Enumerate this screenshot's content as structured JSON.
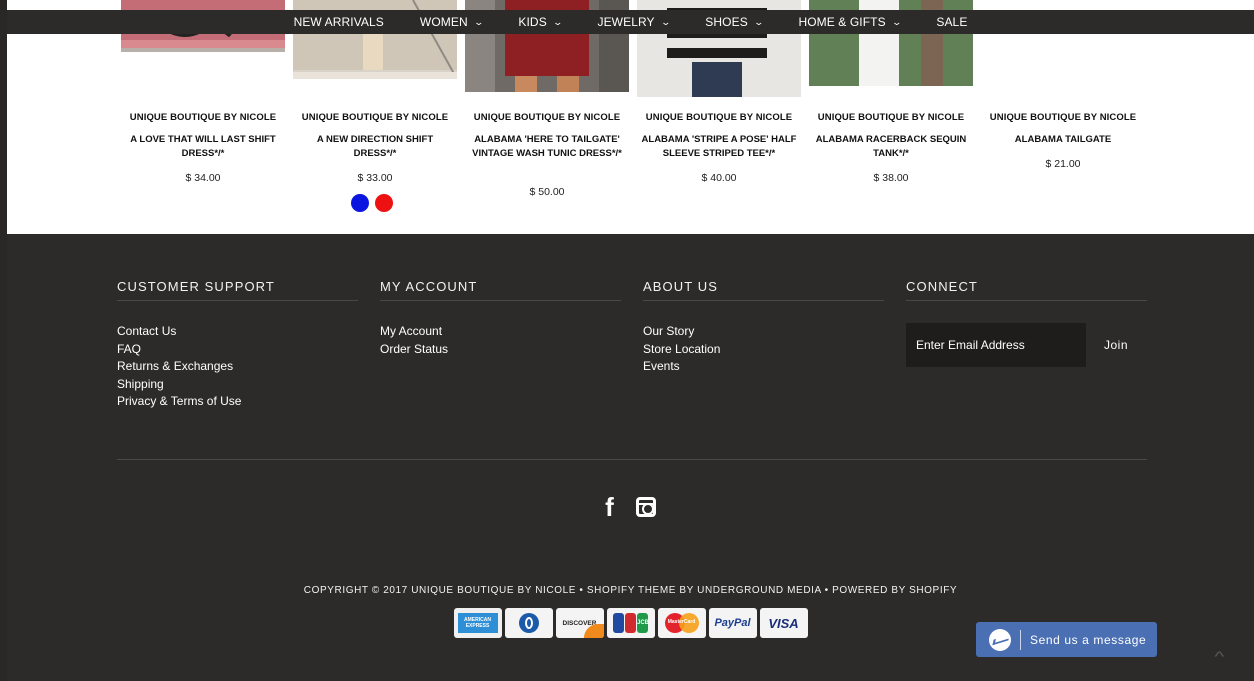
{
  "nav": {
    "items": [
      {
        "label": "NEW ARRIVALS",
        "dropdown": false
      },
      {
        "label": "WOMEN",
        "dropdown": true
      },
      {
        "label": "KIDS",
        "dropdown": true
      },
      {
        "label": "JEWELRY",
        "dropdown": true
      },
      {
        "label": "SHOES",
        "dropdown": true
      },
      {
        "label": "HOME & GIFTS",
        "dropdown": true
      },
      {
        "label": "SALE",
        "dropdown": false
      }
    ]
  },
  "products": [
    {
      "brand": "UNIQUE BOUTIQUE BY NICOLE",
      "title": "A LOVE THAT WILL LAST SHIFT DRESS*/*",
      "price": "$ 34.00"
    },
    {
      "brand": "UNIQUE BOUTIQUE BY NICOLE",
      "title": "A NEW DIRECTION SHIFT DRESS*/*",
      "price": "$ 33.00",
      "swatches": [
        "#0a16e0",
        "#ee1111"
      ]
    },
    {
      "brand": "UNIQUE BOUTIQUE BY NICOLE",
      "title": "ALABAMA 'HERE TO TAILGATE' VINTAGE WASH TUNIC DRESS*/*",
      "price": "$ 50.00"
    },
    {
      "brand": "UNIQUE BOUTIQUE BY NICOLE",
      "title": "ALABAMA 'STRIPE A POSE' HALF SLEEVE STRIPED TEE*/*",
      "price": "$ 40.00"
    },
    {
      "brand": "UNIQUE BOUTIQUE BY NICOLE",
      "title": "ALABAMA RACERBACK SEQUIN TANK*/*",
      "price": "$ 38.00"
    },
    {
      "brand": "UNIQUE BOUTIQUE BY NICOLE",
      "title": "ALABAMA TAILGATE",
      "price": "$ 21.00"
    }
  ],
  "footer": {
    "customer_support": {
      "heading": "CUSTOMER SUPPORT",
      "links": [
        "Contact Us",
        "FAQ",
        "Returns & Exchanges",
        "Shipping",
        "Privacy & Terms of Use"
      ]
    },
    "my_account": {
      "heading": "MY ACCOUNT",
      "links": [
        "My Account",
        "Order Status"
      ]
    },
    "about_us": {
      "heading": "ABOUT US",
      "links": [
        "Our Story",
        "Store Location",
        "Events"
      ]
    },
    "connect": {
      "heading": "CONNECT",
      "email_placeholder": "Enter Email Address",
      "join_label": "Join"
    },
    "social": {
      "facebook_glyph": "f",
      "icons": [
        "facebook-icon",
        "instagram-icon"
      ]
    },
    "copyright": "COPYRIGHT © 2017 UNIQUE BOUTIQUE BY NICOLE • SHOPIFY THEME BY UNDERGROUND MEDIA • POWERED BY SHOPIFY",
    "payments": [
      "AMERICAN EXPRESS",
      "DINERS CLUB",
      "DISCOVER",
      "JCB",
      "MasterCard",
      "PayPal",
      "VISA"
    ]
  },
  "messenger": {
    "label": "Send us a message",
    "scroll_glyph": "^"
  },
  "colors": {
    "nav_bg": "#2d2b29",
    "footer_bg": "#2d2b29",
    "messenger_bg": "#4a6fb3"
  }
}
